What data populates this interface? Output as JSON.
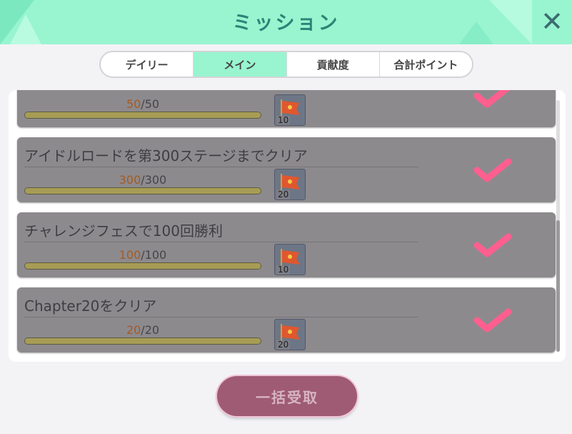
{
  "header": {
    "title": "ミッション",
    "close_icon": "close-icon",
    "bg_color": "#98f5cf"
  },
  "tabs": [
    {
      "label": "デイリー",
      "active": false
    },
    {
      "label": "メイン",
      "active": true
    },
    {
      "label": "貢献度",
      "active": false
    },
    {
      "label": "合計ポイント",
      "active": false
    }
  ],
  "missions": [
    {
      "title": "",
      "current": "50",
      "total": "/50",
      "progress": 1.0,
      "reward_icon": "flag-icon",
      "reward_qty": "10",
      "completed": true
    },
    {
      "title": "アイドルロードを第300ステージまでクリア",
      "current": "300",
      "total": "/300",
      "progress": 1.0,
      "reward_icon": "flag-icon",
      "reward_qty": "20",
      "completed": true
    },
    {
      "title": "チャレンジフェスで100回勝利",
      "current": "100",
      "total": "/100",
      "progress": 1.0,
      "reward_icon": "flag-icon",
      "reward_qty": "10",
      "completed": true
    },
    {
      "title": "Chapter20をクリア",
      "current": "20",
      "total": "/20",
      "progress": 1.0,
      "reward_icon": "flag-icon",
      "reward_qty": "20",
      "completed": true
    }
  ],
  "bulk_button": {
    "label": "一括受取",
    "enabled": false,
    "color": "#9f5b73"
  },
  "colors": {
    "check": "#ff5f8f",
    "card_bg": "#8d8a8e",
    "accent": "#98f5cf"
  }
}
